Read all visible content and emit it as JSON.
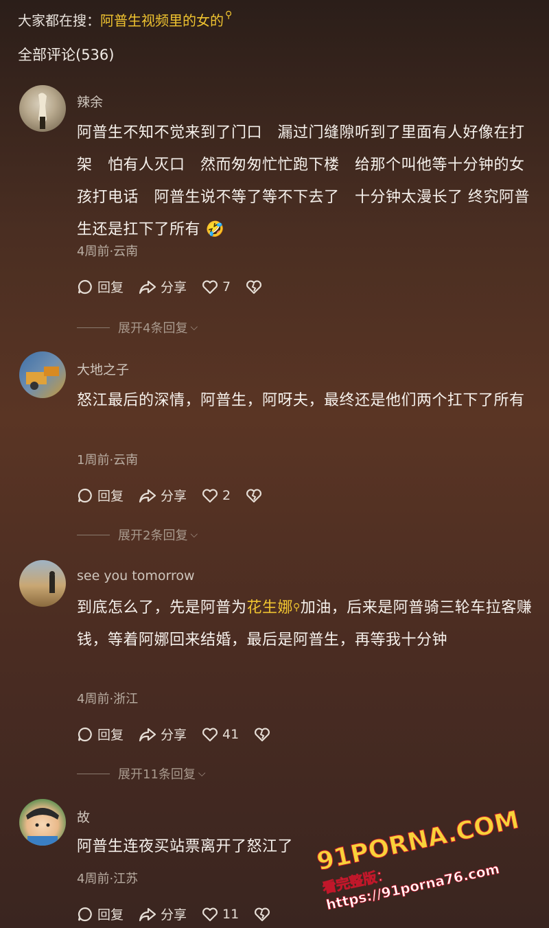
{
  "search": {
    "prefix": "大家都在搜：",
    "keyword": "阿普生视频里的女的"
  },
  "comments_header": "全部评论(536)",
  "comments": [
    {
      "username": "辣余",
      "text": "阿普生不知不觉来到了门口　漏过门缝隙听到了里面有人好像在打架　怕有人灭口　然而匆匆忙忙跑下楼　给那个叫他等十分钟的女孩打电话　阿普生说不等了等不下去了　十分钟太漫长了 终究阿普生还是扛下了所有",
      "emoji": "🤣",
      "meta": "4周前·云南",
      "reply_label": "回复",
      "share_label": "分享",
      "likes": "7",
      "expand": "展开4条回复"
    },
    {
      "username": "大地之子",
      "text": "怒江最后的深情，阿普生，阿呀夫，最终还是他们两个扛下了所有",
      "meta": "1周前·云南",
      "reply_label": "回复",
      "share_label": "分享",
      "likes": "2",
      "expand": "展开2条回复"
    },
    {
      "username": "see you tomorrow",
      "text_before": "到底怎么了，先是阿普为",
      "link": "花生娜",
      "text_after": "加油，后来是阿普骑三轮车拉客赚钱，等着阿娜回来结婚，最后是阿普生，再等我十分钟",
      "meta": "4周前·浙江",
      "reply_label": "回复",
      "share_label": "分享",
      "likes": "41",
      "expand": "展开11条回复"
    },
    {
      "username": "故",
      "text": "阿普生连夜买站票离开了怒江了",
      "meta": "4周前·江苏",
      "reply_label": "回复",
      "share_label": "分享",
      "likes": "11"
    }
  ],
  "watermark": {
    "logo": "91PORNA.COM",
    "sub": "看完整版：https://91porna76.com"
  }
}
